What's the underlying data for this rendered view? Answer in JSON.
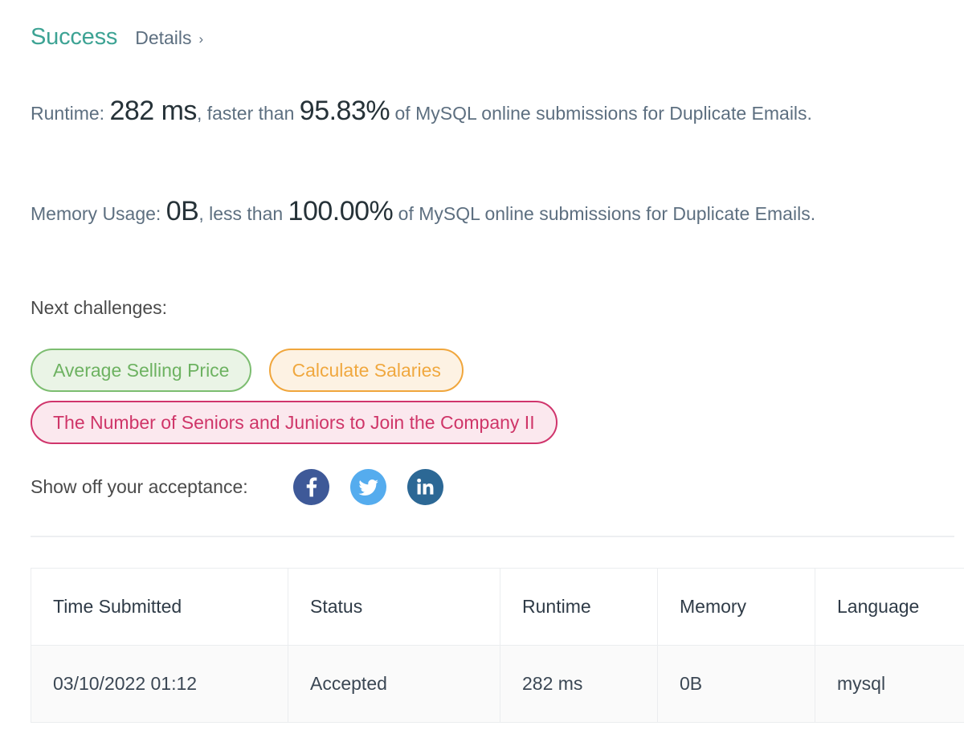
{
  "result": {
    "status_label": "Success",
    "details_label": "Details",
    "details_chevron": "chevron-right-icon",
    "runtime": {
      "prefix": "Runtime: ",
      "value": "282 ms",
      "middle": ", faster than ",
      "percentile": "95.83%",
      "suffix": " of MySQL online submissions for Duplicate Emails."
    },
    "memory": {
      "prefix": "Memory Usage: ",
      "value": "0B",
      "middle": ", less than ",
      "percentile": "100.00%",
      "suffix": " of MySQL online submissions for Duplicate Emails."
    }
  },
  "next_challenges": {
    "label": "Next challenges:",
    "items": [
      {
        "title": "Average Selling Price",
        "color": "#6db261"
      },
      {
        "title": "Calculate Salaries",
        "color": "#f0a83f"
      },
      {
        "title": "The Number of Seniors and Juniors to Join the Company II",
        "color": "#cf3568"
      }
    ]
  },
  "share": {
    "label": "Show off your acceptance:",
    "networks": [
      {
        "name": "facebook",
        "icon": "facebook-icon",
        "color": "#3e5998"
      },
      {
        "name": "twitter",
        "icon": "twitter-icon",
        "color": "#55acee"
      },
      {
        "name": "linkedin",
        "icon": "linkedin-icon",
        "color": "#2c6895"
      }
    ]
  },
  "submissions_table": {
    "columns": [
      "Time Submitted",
      "Status",
      "Runtime",
      "Memory",
      "Language"
    ],
    "rows": [
      {
        "time_submitted": "03/10/2022 01:12",
        "status": "Accepted",
        "runtime": "282 ms",
        "memory": "0B",
        "language": "mysql"
      }
    ]
  },
  "colors": {
    "success": "#3da394",
    "accepted": "#3da394",
    "body_text": "#5d6f80",
    "border": "#ebedef"
  }
}
